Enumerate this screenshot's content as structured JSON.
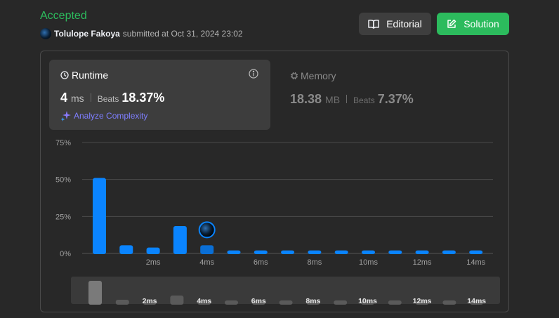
{
  "header": {
    "status": "Accepted",
    "user": "Tolulope Fakoya",
    "submitted_text": "submitted at Oct 31, 2024 23:02"
  },
  "buttons": {
    "editorial": "Editorial",
    "solution": "Solution"
  },
  "runtime": {
    "title": "Runtime",
    "value": "4",
    "unit": "ms",
    "beats_label": "Beats",
    "beats": "18.37%",
    "analyze": "Analyze Complexity"
  },
  "memory": {
    "title": "Memory",
    "value": "18.38",
    "unit": "MB",
    "beats_label": "Beats",
    "beats": "7.37%"
  },
  "colors": {
    "accepted": "#2cbb5d",
    "bar": "#0a84ff",
    "bar_selected": "#0a6fd6",
    "analyze": "#7e7eff"
  },
  "chart_data": {
    "type": "bar",
    "y_ticks": [
      "75%",
      "50%",
      "25%",
      "0%"
    ],
    "ylim": [
      0,
      75
    ],
    "grid": true,
    "x_tick_labels": [
      "2ms",
      "4ms",
      "6ms",
      "8ms",
      "10ms",
      "12ms",
      "14ms"
    ],
    "values": [
      51,
      5.5,
      4,
      18.5,
      5.5,
      2,
      2,
      2,
      2,
      2,
      2,
      2,
      2,
      2,
      2
    ],
    "selected_index": 4,
    "mini_values": [
      32,
      5,
      4,
      11,
      5,
      4,
      4,
      4,
      4,
      4,
      4,
      4,
      4,
      4,
      4
    ],
    "mini_tick_labels": [
      "2ms",
      "4ms",
      "6ms",
      "8ms",
      "10ms",
      "12ms",
      "14ms"
    ]
  }
}
